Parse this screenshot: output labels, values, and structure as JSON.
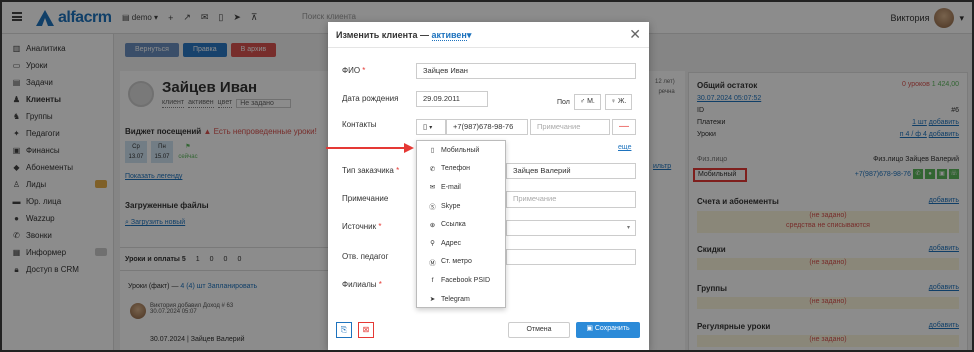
{
  "topbar": {
    "logo": "alfacrm",
    "branch": "demo",
    "search_placeholder": "Поиск клиента",
    "user_name": "Виктория",
    "icons": [
      "plus-icon",
      "wrench-icon",
      "mail-icon",
      "phone-icon",
      "send-icon",
      "cart-icon"
    ]
  },
  "sidebar": {
    "items": [
      {
        "label": "Аналитика",
        "icon": "chart-icon"
      },
      {
        "label": "Уроки",
        "icon": "calendar-icon"
      },
      {
        "label": "Задачи",
        "icon": "tasks-icon"
      },
      {
        "label": "Клиенты",
        "icon": "user-icon"
      },
      {
        "label": "Группы",
        "icon": "group-icon"
      },
      {
        "label": "Педагоги",
        "icon": "teacher-icon"
      },
      {
        "label": "Финансы",
        "icon": "money-icon"
      },
      {
        "label": "Абонементы",
        "icon": "tag-icon"
      },
      {
        "label": "Лиды",
        "icon": "lead-icon"
      },
      {
        "label": "Юр. лица",
        "icon": "company-icon"
      },
      {
        "label": "Wazzup",
        "icon": "chat-icon"
      },
      {
        "label": "Звонки",
        "icon": "call-icon"
      },
      {
        "label": "Информер",
        "icon": "informer-icon"
      },
      {
        "label": "Доступ в CRM",
        "icon": "lock-icon"
      }
    ]
  },
  "main": {
    "buttons": [
      "Вернуться",
      "Правка",
      "В архив"
    ],
    "client_name": "Зайцев Иван",
    "client_tags": [
      "клиент",
      "активен",
      "цвет"
    ],
    "client_select": "Не задано",
    "widget_title": "Виджет посещений",
    "widget_warning": "Есть непроведенные уроки!",
    "visits": [
      {
        "day": "Ср",
        "date": "13.07"
      },
      {
        "day": "Пн",
        "date": "15.07"
      },
      {
        "day": "",
        "date": "сейчас"
      }
    ],
    "legend_link": "Показать легенду",
    "files_title": "Загруженные файлы",
    "upload_link": "Загрузить новый",
    "tabs": [
      "Уроки и оплаты 5",
      "1",
      "0",
      "0",
      "0"
    ],
    "lessons_label": "Уроки (факт)",
    "lessons_count": "4 (4) шт",
    "schedule_link": "Запланировать",
    "feed_author": "Виктория добавил Доход # 63",
    "feed_time": "30.07.2024 05:07",
    "feed_line": "30.07.2024 | Зайцев Валерий",
    "right_stub_1": "12 лет)",
    "right_stub_2": "речна",
    "filter_link": "ильтр"
  },
  "rpanel": {
    "balance_title": "Общий остаток",
    "balance_lessons": "0 уроков",
    "balance_amount": "1 424,00",
    "date_link": "30.07.2024 05:07:52",
    "id_label": "ID",
    "id_value": "#6",
    "payments_label": "Платежи",
    "payments_value": "1 шт",
    "lessons_label": "Уроки",
    "lessons_value": "п 4 / ф 4",
    "add_label": "добавить",
    "person_label": "Физ.лицо",
    "person_value": "Физ.лицо Зайцев Валерий",
    "mobile_label": "Мобильный",
    "mobile_value": "+7(987)678-98-76",
    "accounts_title": "Счета и абонементы",
    "not_set": "(не задано)",
    "no_charge": "средства не списываются",
    "discounts_title": "Скидки",
    "groups_title": "Группы",
    "regular_title": "Регулярные уроки"
  },
  "modal": {
    "title": "Изменить клиента",
    "dash": "—",
    "status": "активен",
    "fio_label": "ФИО",
    "fio_value": "Зайцев Иван",
    "birth_label": "Дата рождения",
    "birth_value": "29.09.2011",
    "sex_label": "Пол",
    "sex_m": "М.",
    "sex_f": "Ж.",
    "contacts_label": "Контакты",
    "phone_value": "+7(987)678-98-76",
    "note_placeholder": "Примечание",
    "more_link": "еще",
    "type_label": "Тип заказчика",
    "type_value": "Зайцев Валерий",
    "note_label": "Примечание",
    "note_field_placeholder": "Примечание",
    "source_label": "Источник",
    "teacher_label": "Отв. педагог",
    "branches_label": "Филиалы",
    "cancel_label": "Отмена",
    "save_label": "Сохранить"
  },
  "dropdown": {
    "items": [
      {
        "label": "Мобильный",
        "icon": "mobile-icon"
      },
      {
        "label": "Телефон",
        "icon": "phone-icon"
      },
      {
        "label": "E-mail",
        "icon": "mail-icon"
      },
      {
        "label": "Skype",
        "icon": "skype-icon"
      },
      {
        "label": "Ссылка",
        "icon": "globe-icon"
      },
      {
        "label": "Адрес",
        "icon": "map-pin-icon"
      },
      {
        "label": "Ст. метро",
        "icon": "metro-icon"
      },
      {
        "label": "Facebook PSID",
        "icon": "facebook-icon"
      },
      {
        "label": "Telegram",
        "icon": "telegram-icon"
      }
    ]
  },
  "colors": {
    "brand": "#1e73be",
    "danger": "#e53935",
    "success": "#5cb85c",
    "highlight_bg": "#fbf6dc"
  }
}
